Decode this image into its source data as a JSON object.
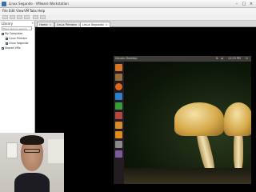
{
  "window": {
    "title": "Linux Segundo - VMware Workstation"
  },
  "menu": [
    "File",
    "Edit",
    "View",
    "VM",
    "Tabs",
    "Help"
  ],
  "library": {
    "title": "Library",
    "search_placeholder": "Type here to search",
    "tree": [
      {
        "label": "My Computer",
        "level": 0
      },
      {
        "label": "Linux Primero",
        "level": 1
      },
      {
        "label": "Linux Segundo",
        "level": 1
      },
      {
        "label": "Shared VMs",
        "level": 0
      }
    ]
  },
  "tabs": [
    {
      "label": "Home",
      "active": false
    },
    {
      "label": "Linux Primero",
      "active": false
    },
    {
      "label": "Linux Segundo",
      "active": true
    }
  ],
  "guest": {
    "panel_title": "Ubuntu Desktop",
    "clock": "11:23 PM",
    "launcher_icons": [
      "dash-icon",
      "files-icon",
      "firefox-icon",
      "writer-icon",
      "calc-icon",
      "impress-icon",
      "software-center-icon",
      "amazon-icon",
      "settings-icon",
      "workspaces-icon"
    ]
  },
  "colors": {
    "ubuntu_panel": "#3c3b37",
    "launcher_bg": "#2a1f2a",
    "vm_background": "#000000",
    "vmware_chrome": "#efefef"
  }
}
